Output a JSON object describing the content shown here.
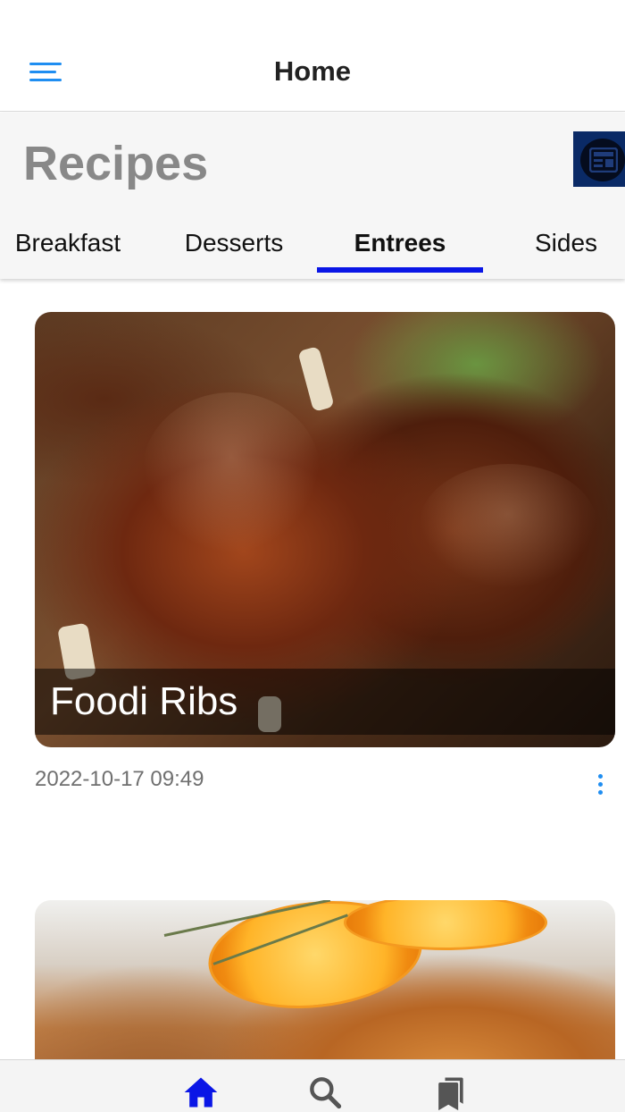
{
  "app_bar": {
    "title": "Home",
    "menu_icon": "hamburger-menu-icon",
    "accent": "#1f8ef1"
  },
  "header": {
    "title": "Recipes",
    "action_icon": "newspaper-icon"
  },
  "tabs": [
    {
      "label": "Breakfast"
    },
    {
      "label": "Desserts"
    },
    {
      "label": "Entrees",
      "selected": true
    },
    {
      "label": "Sides"
    }
  ],
  "tab_indicator_color": "#0a16e6",
  "recipes": [
    {
      "title": "Foodi Ribs",
      "timestamp": "2022-10-17 09:49",
      "image": "ribs-image",
      "menu_icon": "more-vertical-icon"
    },
    {
      "image": "roast-chicken-with-orange-image"
    }
  ],
  "bottom_nav": [
    {
      "icon": "home-icon",
      "active": true,
      "color": "#0a16e6"
    },
    {
      "icon": "search-icon",
      "active": false,
      "color": "#555555"
    },
    {
      "icon": "bookmarks-icon",
      "active": false,
      "color": "#555555"
    }
  ]
}
